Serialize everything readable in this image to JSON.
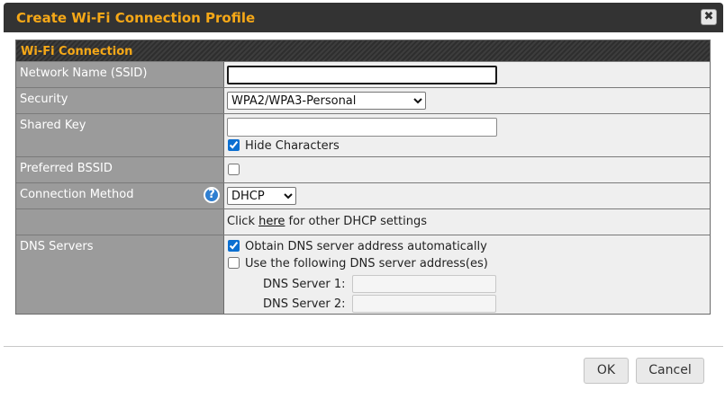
{
  "dialog": {
    "title": "Create Wi-Fi Connection Profile",
    "close_glyph": "✖"
  },
  "section": {
    "header": "Wi-Fi Connection"
  },
  "fields": {
    "ssid": {
      "label": "Network Name (SSID)",
      "value": ""
    },
    "security": {
      "label": "Security",
      "selected": "WPA2/WPA3-Personal"
    },
    "shared_key": {
      "label": "Shared Key",
      "value": "",
      "hide_characters_label": "Hide Characters",
      "hide_characters_checked": true
    },
    "preferred_bssid": {
      "label": "Preferred BSSID",
      "checked": false
    },
    "connection_method": {
      "label": "Connection Method",
      "selected": "DHCP",
      "help_glyph": "?"
    },
    "dhcp_settings": {
      "prefix": "Click ",
      "link": "here",
      "suffix": " for other DHCP settings"
    },
    "dns": {
      "label": "DNS Servers",
      "auto_label": "Obtain DNS server address automatically",
      "auto_checked": true,
      "manual_label": "Use the following DNS server address(es)",
      "manual_checked": false,
      "server1_label": "DNS Server 1:",
      "server2_label": "DNS Server 2:",
      "server1_value": "",
      "server2_value": ""
    }
  },
  "buttons": {
    "ok": "OK",
    "cancel": "Cancel"
  },
  "colors": {
    "accent": "#f6a817",
    "title_bar": "#333333",
    "label_bg": "#9b9b9b",
    "value_bg": "#efefef"
  }
}
